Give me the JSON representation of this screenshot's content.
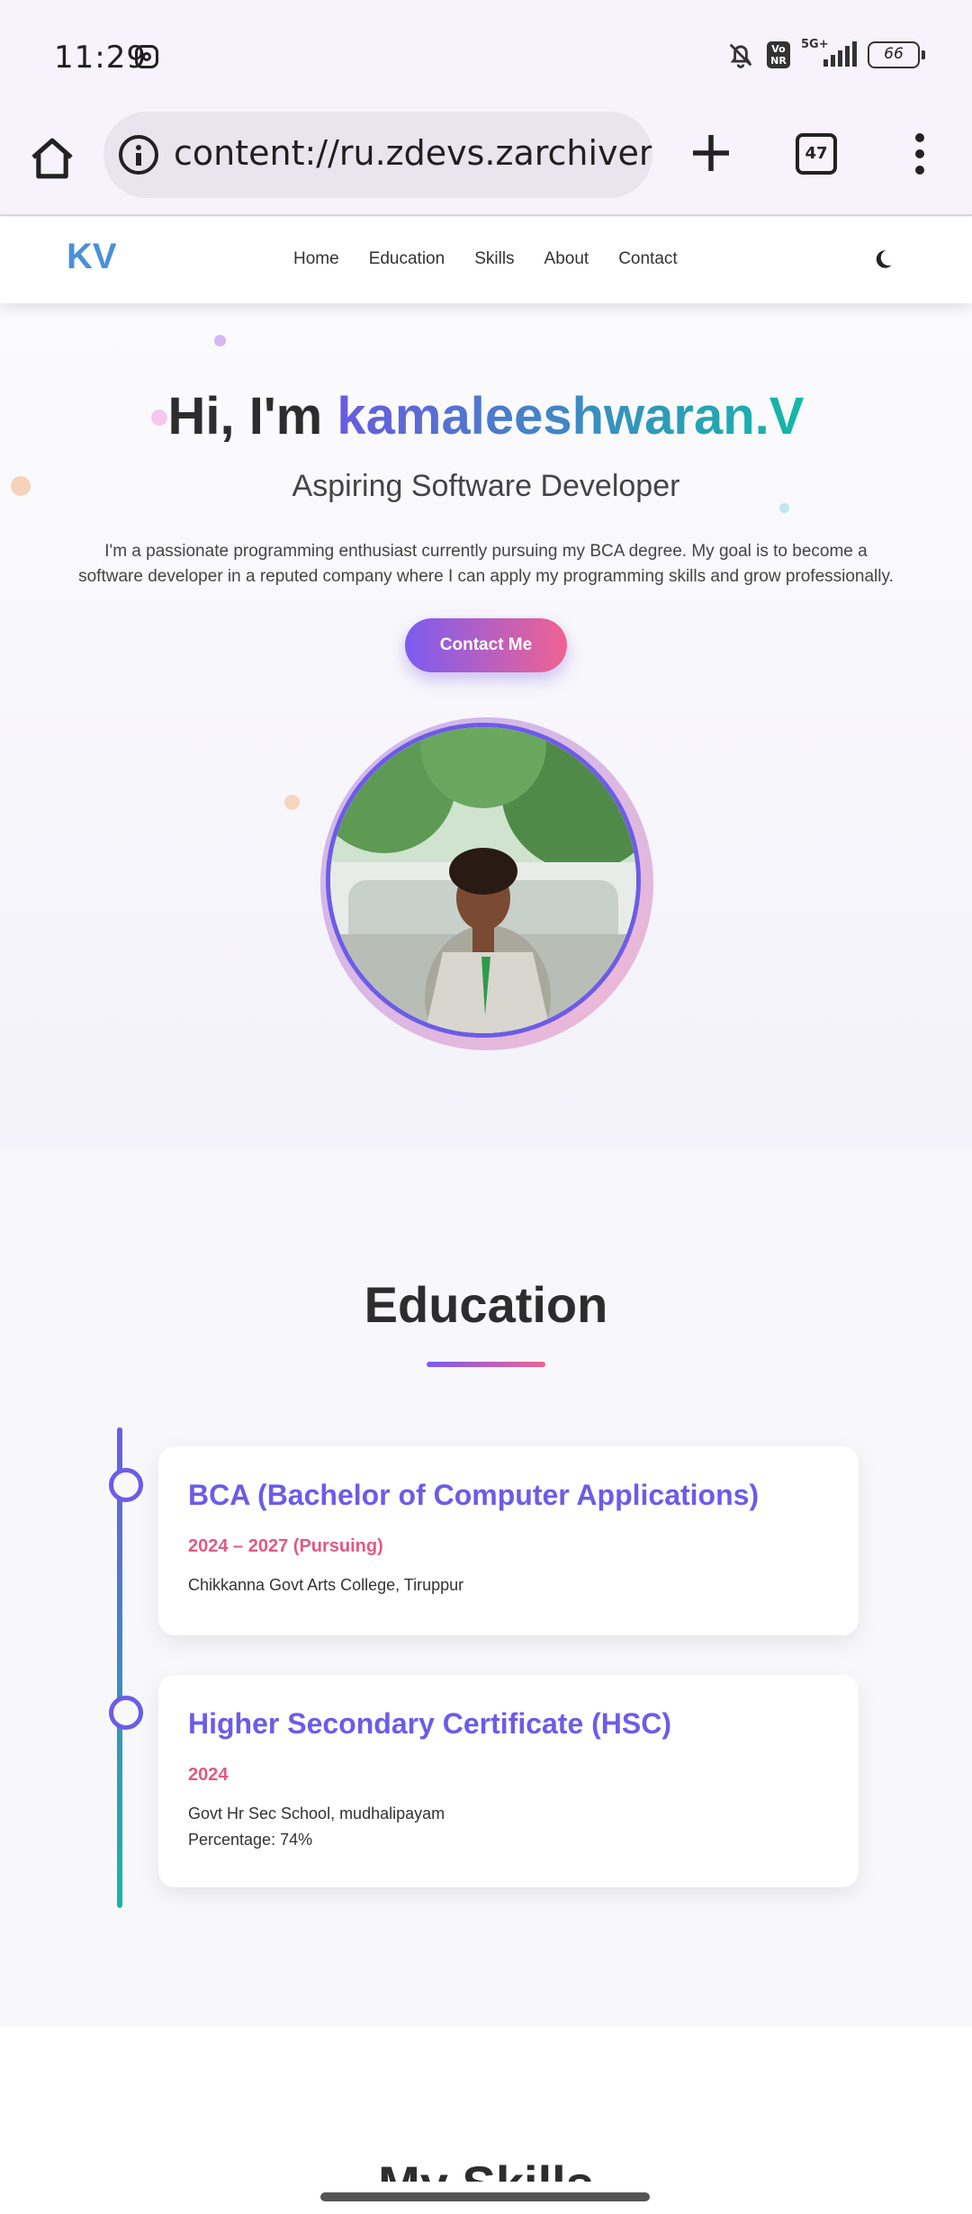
{
  "status_bar": {
    "time": "11:29",
    "network": "5G+",
    "battery": "66",
    "icons": [
      "instagram-icon",
      "bell-off-icon",
      "volte-icon",
      "signal-icon",
      "battery-icon"
    ]
  },
  "browser": {
    "url": "content://ru.zdevs.zarchiver.ex",
    "tab_count": "47",
    "icons": [
      "home-icon",
      "info-icon",
      "plus-icon",
      "tabs-icon",
      "more-vert-icon"
    ]
  },
  "site_nav": {
    "logo": "KV",
    "links": [
      "Home",
      "Education",
      "Skills",
      "About",
      "Contact"
    ],
    "theme_toggle_icon": "moon-icon"
  },
  "hero": {
    "greeting": "Hi, I'm ",
    "name": "kamaleeshwaran.V",
    "subtitle": "Aspiring Software Developer",
    "intro": "I'm a passionate programming enthusiast currently pursuing my BCA degree. My goal is to become a software developer in a reputed company where I can apply my programming skills and grow professionally.",
    "cta": "Contact Me",
    "photo": "profile-photo"
  },
  "education": {
    "heading": "Education",
    "entries": [
      {
        "degree": "BCA (Bachelor of Computer Applications)",
        "years": "2024 – 2027 (Pursuing)",
        "lines": [
          "Chikkanna Govt Arts College, Tiruppur"
        ]
      },
      {
        "degree": "Higher Secondary Certificate (HSC)",
        "years": "2024",
        "lines": [
          "Govt Hr Sec School, mudhalipayam",
          "Percentage: 74%"
        ]
      }
    ]
  },
  "skills": {
    "heading": "My Skills"
  },
  "colors": {
    "accent_purple": "#6c5ce7",
    "accent_pink": "#f06292",
    "accent_teal": "#14b8a6",
    "logo_blue": "#4a90d9",
    "year_pink": "#e05a82"
  }
}
